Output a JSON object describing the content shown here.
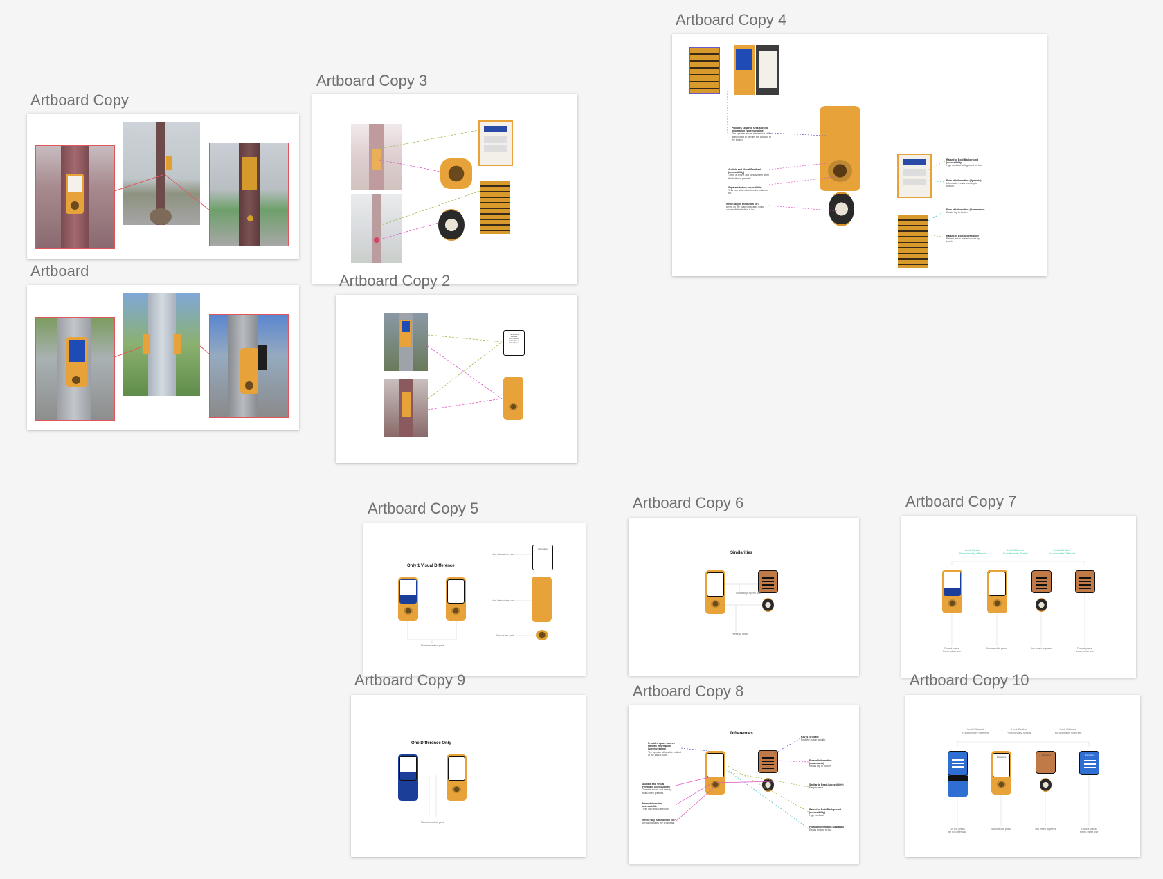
{
  "artboards": {
    "copy": {
      "title": "Artboard Copy"
    },
    "base": {
      "title": "Artboard"
    },
    "copy2": {
      "title": "Artboard Copy 2",
      "card_text": "Instructions\nRelease\nLorem ipsum\nLorem ipsum\nLorem ipsum"
    },
    "copy3": {
      "title": "Artboard Copy 3"
    },
    "copy4": {
      "title": "Artboard Copy 4",
      "notes_left": [
        {
          "heading": "Provides space to seek specific information (screenreading)",
          "body": "The speaker allows the instinct of the lateral point to identify the location of the button."
        },
        {
          "heading": "Audible and Visual Feedback (accessibility)",
          "body": "There is a tone and steady flash when the button is pressed."
        },
        {
          "heading": "Separate button accessibility",
          "body": "Tells you which direction the button is for."
        },
        {
          "heading": "Which way is the button for?",
          "body": "Arrow on the button indicates which crosswalk the button is for."
        }
      ],
      "notes_right": [
        {
          "heading": "Raised or Bold Background (accessibility)",
          "body": "High contrast background for text."
        },
        {
          "heading": "Flow of Information (Upwards)",
          "body": "Information reads from top to bottom."
        },
        {
          "heading": "Flow of Information (Downwards)",
          "body": "Reads top to bottom."
        },
        {
          "heading": "Raised or Bold Accessibility",
          "body": "Raised text is easier to read by touch."
        }
      ]
    },
    "copy5": {
      "title": "Artboard Copy 5",
      "heading": "Only 1 Visual Difference",
      "label_top": "Non interactive part",
      "label_mid": "Non interactive part",
      "label_bottom": "Interactive part",
      "label_under": "Non interactive part",
      "card_text": "Instructions"
    },
    "copy6": {
      "title": "Artboard Copy 6",
      "heading": "Similarities",
      "label_mid": "Stand to properly use",
      "label_bottom": "Press to cross",
      "card_text": "Instructions"
    },
    "copy7": {
      "title": "Artboard Copy 7",
      "tags": [
        "Look Similar\nFunctionality different",
        "Look Different\nFunctionality Similar",
        "Look Similar\nFunctionality Different"
      ],
      "captions": [
        "Do not press\nfor no other use",
        "You need to press",
        "You need to press",
        "Do not press\nfor no other use"
      ],
      "card_text": "Instructions"
    },
    "copy8": {
      "title": "Artboard Copy 8",
      "heading": "Differences",
      "notes_left": [
        {
          "heading": "Provides space to seek specific information (screenreading)",
          "body": "The speaker allows the instinct of the lateral point."
        },
        {
          "heading": "Audible and Visual Feedback (accessibility)",
          "body": "There is a tone and steady flash when pressed."
        },
        {
          "heading": "Marked direction accessibility",
          "body": "Tells you which direction."
        },
        {
          "heading": "Which way is the button for?",
          "body": "Arrow indicates the crosswalk."
        }
      ],
      "notes_right": [
        {
          "heading": "Key is to locate",
          "body": "Find the button quickly."
        },
        {
          "heading": "Flow of Information (downwards)",
          "body": "Reads top to bottom."
        },
        {
          "heading": "Similar to Read (accessibility)",
          "body": "Easy to read."
        },
        {
          "heading": "Raised or Bold Background (accessibility)",
          "body": "High contrast."
        },
        {
          "heading": "Flow of Information (upwards)",
          "body": "Reads bottom to top."
        }
      ],
      "card_text": "Instructions"
    },
    "copy9": {
      "title": "Artboard Copy 9",
      "heading": "One Difference Only",
      "label_under": "Non interactive part",
      "card_text": "Instructions"
    },
    "copy10": {
      "title": "Artboard Copy 10",
      "tags": [
        "Look Different\nFunctionality different",
        "Look Similar\nFunctionality Similar",
        "Look Different\nFunctionality Different"
      ],
      "captions": [
        "Do not press\nfor no other use",
        "You need to press",
        "You need to press",
        "Do not press\nfor no other use"
      ],
      "card_text": "Instructions"
    }
  },
  "colors": {
    "canvas": "#f5f5f5",
    "label": "#707070",
    "orange": "#e8a23a",
    "brown": "#c07a47",
    "navy": "#1b3f99",
    "blue": "#2f6fd4",
    "red_line": "#e0565a",
    "pink_line": "#e04fc3",
    "green_line": "#9bb84a",
    "purple_line": "#6a5acd",
    "cyan_line": "#3cc3c8",
    "teal_text": "#33c9a6"
  }
}
